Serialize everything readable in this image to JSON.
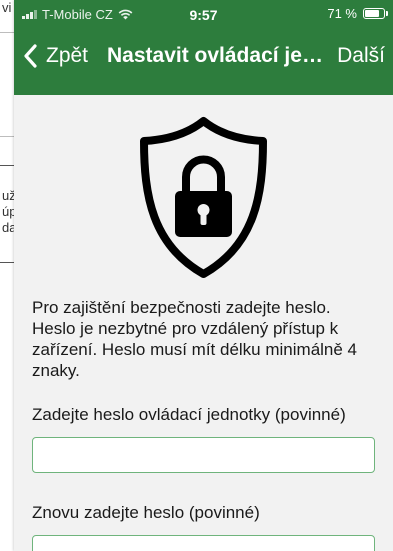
{
  "background": {
    "fragments": [
      "vi",
      "už",
      "úp",
      "da"
    ]
  },
  "status_bar": {
    "carrier": "T-Mobile CZ",
    "time": "9:57",
    "battery": "71 %",
    "battery_level": 0.71
  },
  "nav": {
    "back_label": "Zpět",
    "title": "Nastavit ovládací jed...",
    "next_label": "Další"
  },
  "content": {
    "description": "Pro zajištění bezpečnosti zadejte heslo. Heslo je nezbytné pro vzdálený přístup k zařízení. Heslo musí mít délku minimálně 4 znaky.",
    "password_label": "Zadejte heslo ovládací jednotky (povinné)",
    "password_value": "",
    "confirm_label": "Znovu zadejte heslo (povinné)",
    "confirm_value": ""
  },
  "colors": {
    "nav_green": "#2d7d3d",
    "field_border": "#6fb47c",
    "background": "#f2f2f2"
  },
  "icons": [
    "chevron-left-icon",
    "shield-lock-icon",
    "signal-icon",
    "wifi-icon",
    "battery-icon"
  ]
}
